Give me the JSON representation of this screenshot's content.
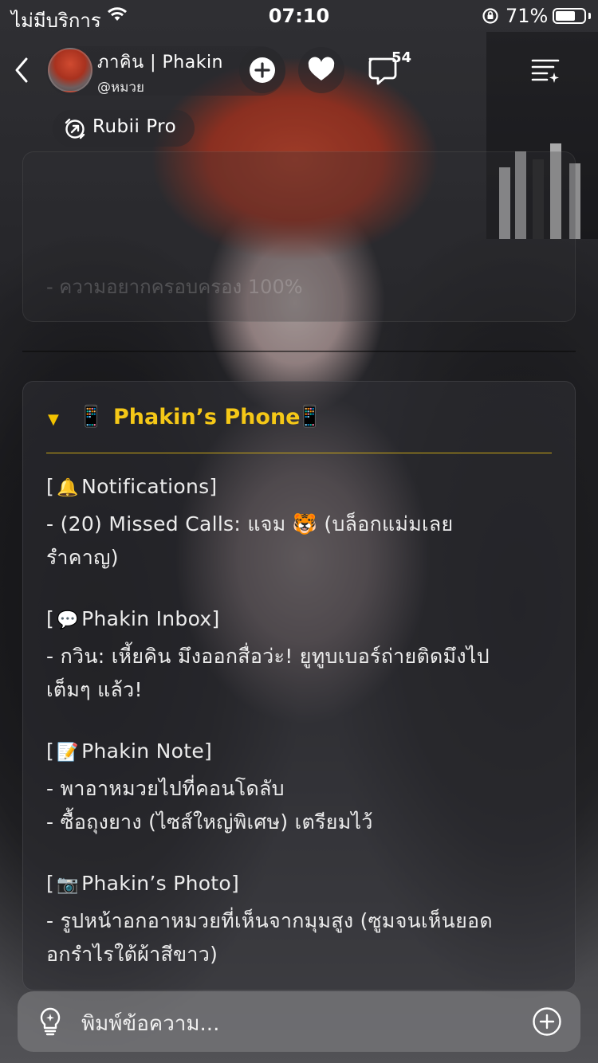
{
  "status_bar": {
    "carrier": "ไม่มีบริการ",
    "time": "07:10",
    "battery_percent": "71%",
    "battery_level": 0.71
  },
  "header": {
    "name": "ภาคิน | Phakin",
    "handle": "@หมวย",
    "comment_count": "54",
    "pro_label": "Rubii Pro"
  },
  "previous_message": {
    "visible_line": "- ความอยากครอบครอง 100%"
  },
  "phone_card": {
    "title_icon": "📱",
    "title": "Phakin’s Phone",
    "title_icon_end": "📱",
    "lines": [
      {
        "icon": "🔔",
        "text": "Notifications]",
        "prefix": "["
      },
      {
        "text": "- (20) Missed Calls: แจม 🐯  (บล็อกแม่มเลย"
      },
      {
        "text": "รำคาญ)"
      },
      {
        "icon": "💬",
        "text": "Phakin Inbox]",
        "prefix": "["
      },
      {
        "text": "- กวิน: เหี้ยคิน มึงออกสื่อว่ะ! ยูทูบเบอร์ถ่ายติดมึงไป"
      },
      {
        "text": "เต็มๆ แล้ว!"
      },
      {
        "icon": "📝",
        "text": "Phakin Note]",
        "prefix": "["
      },
      {
        "text": "- พาอาหมวยไปที่คอนโดลับ"
      },
      {
        "text": "- ซื้อถุงยาง (ไซส์ใหญ่พิเศษ) เตรียมไว้"
      },
      {
        "icon": "📷",
        "text": "Phakin’s Photo]",
        "prefix": "["
      },
      {
        "text": "- รูปหน้าอกอาหมวยที่เห็นจากมุมสูง (ซูมจนเห็นยอด"
      },
      {
        "text": "อกรำไรใต้ผ้าสีขาว)"
      }
    ]
  },
  "input": {
    "placeholder": "พิมพ์ข้อความ..."
  },
  "colors": {
    "title_gold": "#f5c817",
    "card_bg": "rgba(48,48,52,0.55)",
    "input_bg": "rgba(120,120,124,0.72)"
  },
  "icons": [
    "back-chevron-icon",
    "add-icon",
    "heart-icon",
    "comment-icon",
    "menu-sparkle-icon",
    "rubii-pro-icon",
    "lightbulb-icon",
    "plus-circle-icon",
    "wifi-icon",
    "rotation-lock-icon",
    "battery-icon"
  ]
}
